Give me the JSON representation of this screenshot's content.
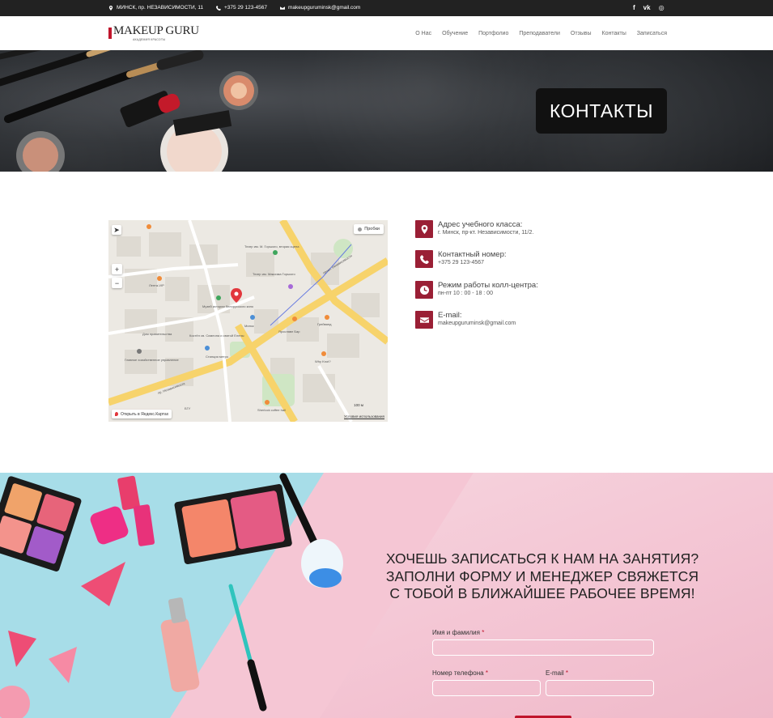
{
  "topbar": {
    "address": "МИНСК, пр. НЕЗАВИСИМОСТИ, 11",
    "phone": "+375 29 123-4567",
    "email": "makeupguruminsk@gmail.com",
    "social": [
      {
        "icon": "facebook-icon",
        "glyph": "f"
      },
      {
        "icon": "vk-icon",
        "glyph": "vk"
      },
      {
        "icon": "instagram-icon",
        "glyph": "◎"
      }
    ]
  },
  "header": {
    "logo_name": "MAKEUP GURU",
    "logo_sub": "АКАДЕМИЯ КРАСОТЫ",
    "nav": [
      "О Нас",
      "Обучение",
      "Портфолио",
      "Преподаватели",
      "Отзывы",
      "Контакты",
      "Записаться"
    ]
  },
  "hero": {
    "title": "КОНТАКТЫ"
  },
  "map": {
    "traffic_label": "Пробки",
    "zoom_in": "+",
    "zoom_out": "−",
    "open_label": "Открыть в Яндекс.Картах",
    "terms_label": "Условия использования",
    "scale_label": "100 м",
    "places": [
      "Театр им. М. Горького, вторая сцена",
      "Театр им. Максима Горького",
      "Лента-VIP",
      "Музей истории белорусского кино",
      "Дом правительства",
      "Костёл св. Симеона и святой Елены",
      "Главное хозяйственное управление",
      "Станция метро",
      "Минск",
      "Ярославл Бар",
      "Грейвянд",
      "Why Knot?",
      "Sherlock coffee hall",
      "БГУ",
      "пр. Независимости",
      "просп. Независимости"
    ]
  },
  "contacts": [
    {
      "icon": "location-pin-icon",
      "label": "Адрес учебного класса:",
      "value": "г. Минск, пр-кт. Независимости, 11/2."
    },
    {
      "icon": "phone-icon",
      "label": "Контактный номер:",
      "value": "+375 29 123-4567"
    },
    {
      "icon": "clock-icon",
      "label": "Режим работы колл-центра:",
      "value": "пн-пт 10 : 00 - 18 : 00"
    },
    {
      "icon": "envelope-icon",
      "label": "E-mail:",
      "value": "makeupguruminsk@gmail.com"
    }
  ],
  "signup": {
    "heading": "ХОЧЕШЬ ЗАПИСАТЬСЯ К НАМ НА ЗАНЯТИЯ? ЗАПОЛНИ ФОРМУ И МЕНЕДЖЕР СВЯЖЕТСЯ С ТОБОЙ В БЛИЖАЙШЕЕ РАБОЧЕЕ ВРЕМЯ!",
    "name_label": "Имя и фамилия",
    "phone_label": "Номер телефона",
    "email_label": "E-mail",
    "required_mark": "*",
    "name_value": "",
    "phone_value": "",
    "email_value": ""
  },
  "colors": {
    "accent": "#9a1f35",
    "topbar": "#222222",
    "required": "#c0152c",
    "pink": "#f5c6d4",
    "blue": "#a7dde8"
  }
}
